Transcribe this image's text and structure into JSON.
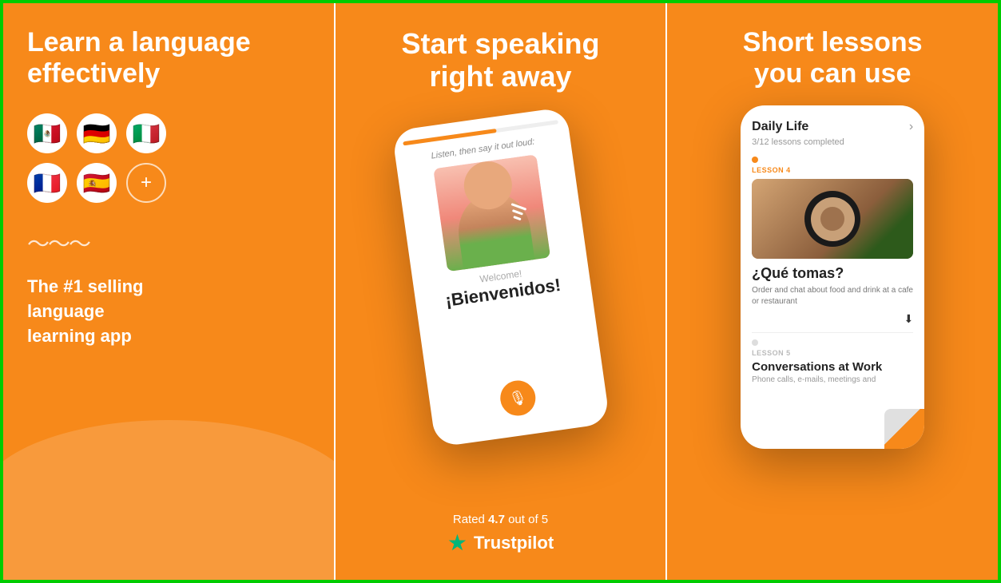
{
  "border_color": "#00cc00",
  "bg_color": "#F7891A",
  "panel1": {
    "title_line1": "Learn a language",
    "title_line2": "effectively",
    "flags": [
      "🇲🇽",
      "🇩🇪",
      "🇮🇹",
      "🇫🇷",
      "🇪🇸"
    ],
    "plus_label": "+",
    "wave": "〜〜〜",
    "subtitle_line1": "The #1 selling",
    "subtitle_line2": "language",
    "subtitle_line3": "learning app"
  },
  "panel2": {
    "title_line1": "Start speaking",
    "title_line2": "right away",
    "phone": {
      "instruction": "Listen, then say it out loud:",
      "welcome": "Welcome!",
      "bienvenidos": "¡Bien venidos!",
      "mic_icon": "🎙"
    },
    "rating_text": "Rated ",
    "rating_value": "4.7",
    "rating_suffix": " out of 5",
    "trustpilot_label": "Trustpilot"
  },
  "panel3": {
    "title_line1": "Short lessons",
    "title_line2": "you can use",
    "phone": {
      "section_title": "Daily Life",
      "lessons_completed": "3/12 lessons completed",
      "lesson4_label": "LESSON 4",
      "lesson4_title": "¿Qué tomas?",
      "lesson4_desc": "Order and chat about food and drink at a cafe or restaurant",
      "lesson5_label": "LESSON 5",
      "lesson5_title": "Conversations at Work",
      "lesson5_desc": "Phone calls, e-mails, meetings and"
    }
  }
}
